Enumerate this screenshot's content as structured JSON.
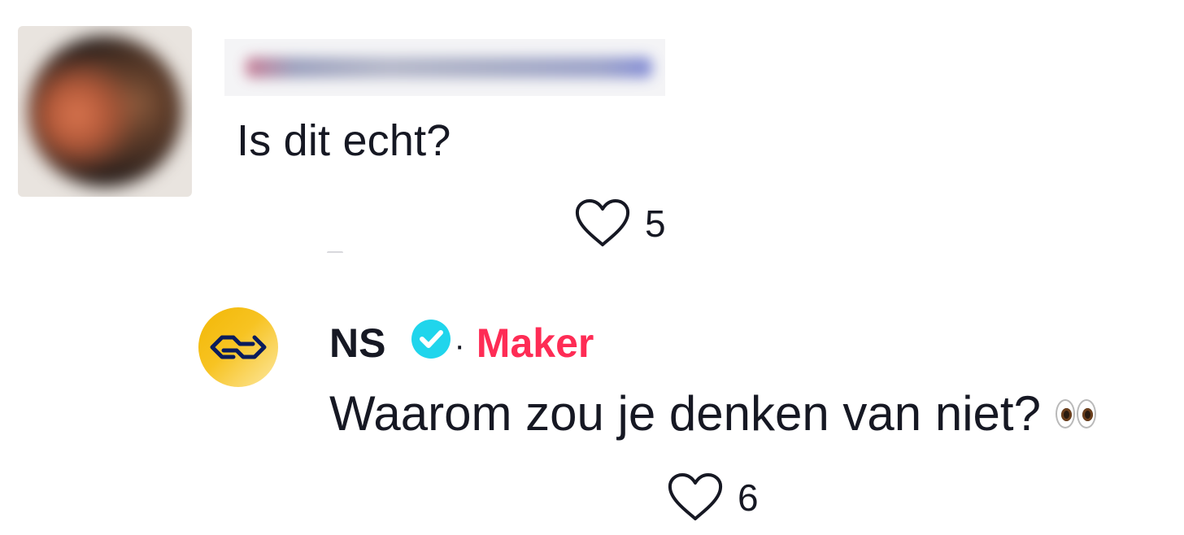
{
  "comment": {
    "text": "Is dit echt?",
    "likes": "5"
  },
  "reply": {
    "author": "NS",
    "separator": "·",
    "role_badge": "Maker",
    "text": "Waarom zou je denken van niet?",
    "likes": "6"
  },
  "colors": {
    "maker": "#fe2c55",
    "verified": "#20d5ec",
    "text": "#161823",
    "ns_yellow": "#f7c322",
    "ns_blue": "#0a1b5c"
  },
  "icons": {
    "like": "heart-outline-icon",
    "verified": "verified-check-icon",
    "reply_emoji": "eyes-emoji-icon"
  }
}
